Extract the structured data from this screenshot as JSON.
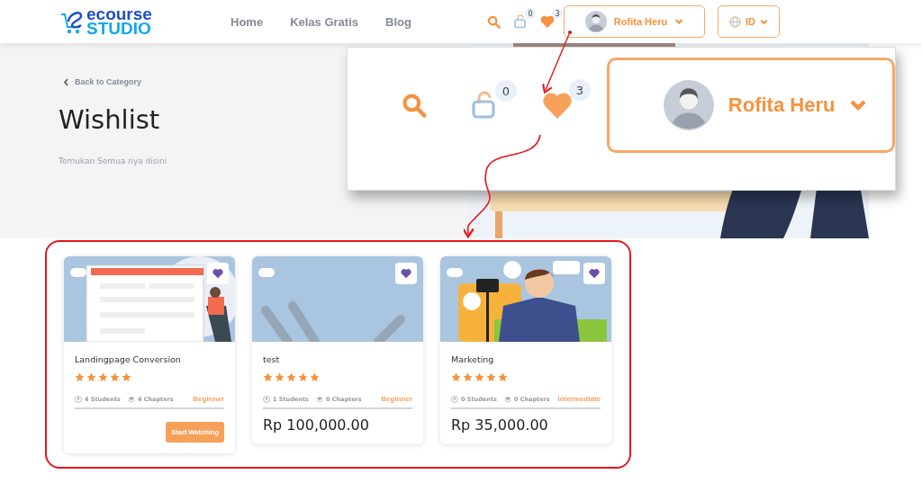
{
  "header": {
    "logo": {
      "line1": "ecourse",
      "line2": "STUDIO"
    },
    "nav": [
      {
        "label": "Home"
      },
      {
        "label": "Kelas Gratis"
      },
      {
        "label": "Blog"
      }
    ],
    "cart_count": "0",
    "wishlist_count": "3",
    "user": "Rofita Heru",
    "language": "ID"
  },
  "hero": {
    "back_link": "Back to Category",
    "title": "Wishlist",
    "subtitle": "Temukan Semua nya disini"
  },
  "callout": {
    "cart_count": "0",
    "wishlist_count": "3",
    "user": "Rofita Heru"
  },
  "cards": [
    {
      "wishlisted": true,
      "title": "Landingpage Conversion",
      "stars": 5,
      "students": "4 Students",
      "chapters": "4 Chapters",
      "level": "Beginner",
      "action": {
        "kind": "button",
        "label": "Start Watching"
      }
    },
    {
      "wishlisted": true,
      "title": "test",
      "stars": 5,
      "students": "1 Students",
      "chapters": "0 Chapters",
      "level": "Beginner",
      "action": {
        "kind": "price",
        "label": "Rp 100,000.00"
      }
    },
    {
      "wishlisted": true,
      "title": "Marketing",
      "stars": 5,
      "students": "0 Students",
      "chapters": "0 Chapters",
      "level": "Intermediate",
      "action": {
        "kind": "price",
        "label": "Rp 35,000.00"
      }
    }
  ]
}
